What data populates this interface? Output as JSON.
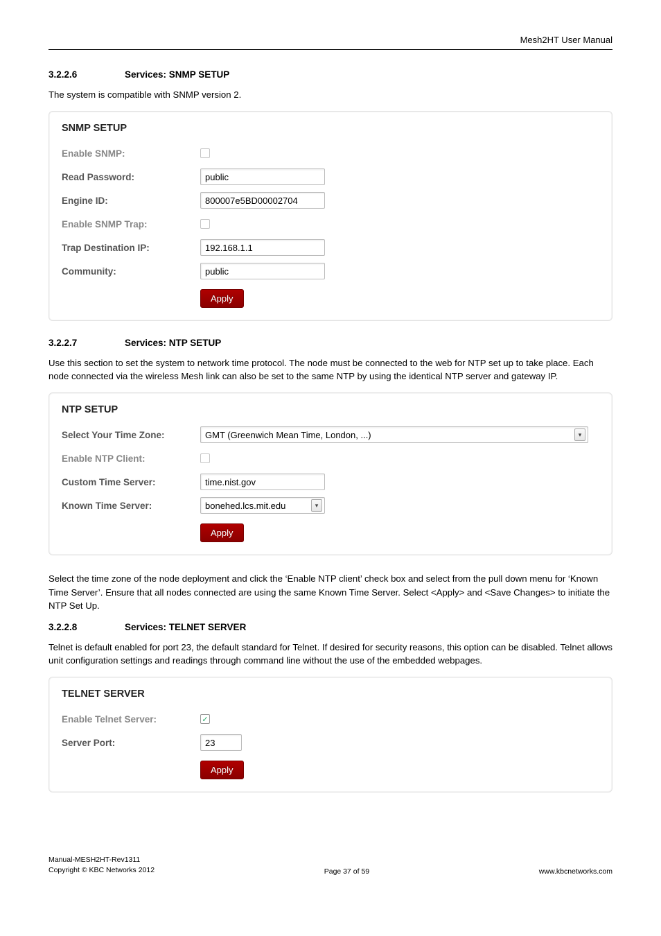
{
  "header": {
    "product": "Mesh2HT User Manual"
  },
  "sec_snmp": {
    "num": "3.2.2.6",
    "title": "Services: SNMP SETUP",
    "intro": "The system is compatible with SNMP version 2.",
    "panel_title": "SNMP SETUP",
    "rows": {
      "enable_snmp_label": "Enable SNMP:",
      "read_password_label": "Read Password:",
      "read_password_value": "public",
      "engine_id_label": "Engine ID:",
      "engine_id_value": "800007e5BD00002704",
      "enable_trap_label": "Enable SNMP Trap:",
      "trap_dest_label": "Trap Destination IP:",
      "trap_dest_value": "192.168.1.1",
      "community_label": "Community:",
      "community_value": "public"
    },
    "apply": "Apply"
  },
  "sec_ntp": {
    "num": "3.2.2.7",
    "title": "Services: NTP SETUP",
    "intro": "Use this section to set the system to network time protocol. The node must be connected to the web for NTP set up to take place. Each node connected via the wireless Mesh link can also be set to the same NTP by using the identical NTP server and gateway IP.",
    "panel_title": "NTP SETUP",
    "rows": {
      "tz_label": "Select Your Time Zone:",
      "tz_value": "GMT (Greenwich Mean Time, London, ...)",
      "enable_client_label": "Enable NTP Client:",
      "custom_label": "Custom Time Server:",
      "custom_value": "time.nist.gov",
      "known_label": "Known Time Server:",
      "known_value": "bonehed.lcs.mit.edu"
    },
    "apply": "Apply",
    "outro": "Select the time zone of the node deployment and click the ‘Enable NTP client’ check box and select from the pull down menu for ‘Known Time Server’. Ensure that all nodes connected are using the same Known Time Server. Select <Apply> and <Save Changes> to initiate the NTP Set Up."
  },
  "sec_telnet": {
    "num": "3.2.2.8",
    "title": "Services: TELNET SERVER",
    "intro": "Telnet is default enabled for port 23, the default standard for Telnet. If desired for security reasons, this option can be disabled. Telnet allows unit configuration settings and readings through command line without the use of the embedded webpages.",
    "panel_title": "TELNET SERVER",
    "rows": {
      "enable_label": "Enable Telnet Server:",
      "port_label": "Server Port:",
      "port_value": "23"
    },
    "apply": "Apply"
  },
  "footer": {
    "line1": "Manual-MESH2HT-Rev1311",
    "line2": "Copyright © KBC Networks 2012",
    "center": "Page 37 of 59",
    "right": "www.kbcnetworks.com"
  }
}
